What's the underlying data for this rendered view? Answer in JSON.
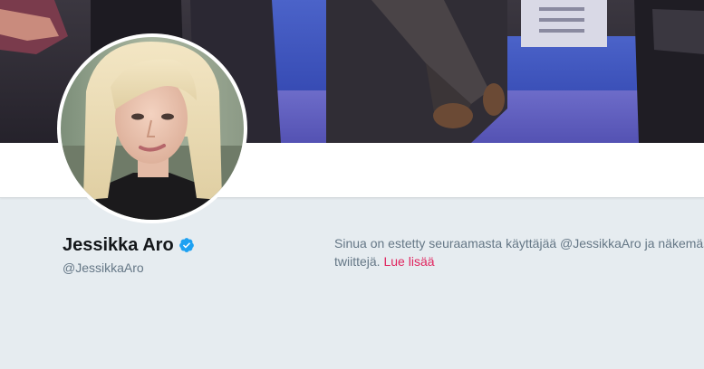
{
  "profile": {
    "name": "Jessikka Aro",
    "handle": "@JessikkaAro",
    "verified": true
  },
  "blocked_notice": {
    "line1": "Sinua on estetty seuraamasta käyttäjää @JessikkaAro ja näkemästä",
    "line2": "twiittejä.",
    "link_label": "Lue lisää"
  },
  "colors": {
    "background": "#e6ecf0",
    "verified": "#1da1f2",
    "link": "#e0245e",
    "muted_text": "#657786",
    "name_text": "#14171a"
  },
  "icons": {
    "verified": "verified-badge-icon"
  }
}
